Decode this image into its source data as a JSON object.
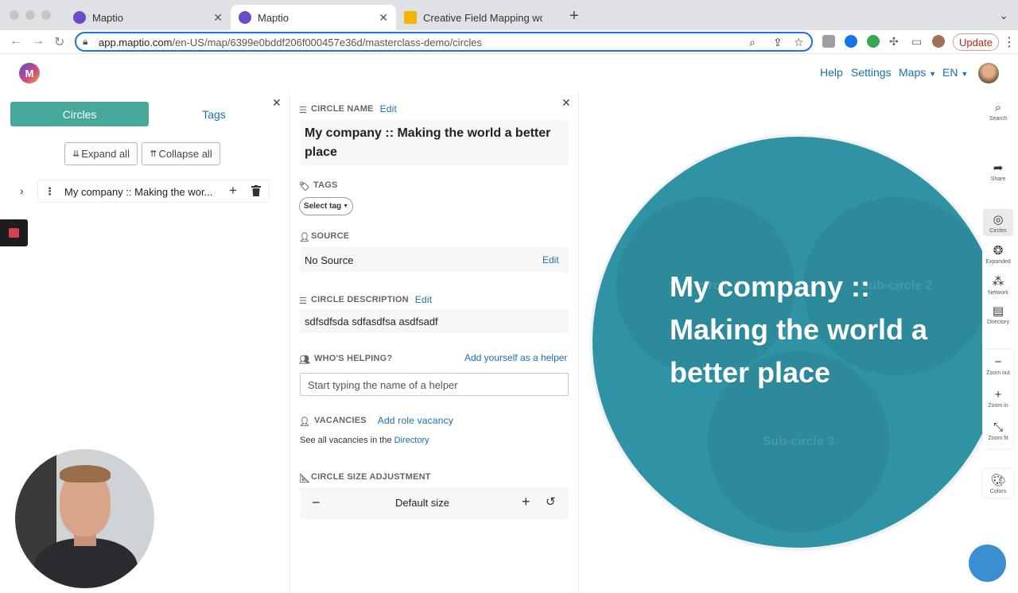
{
  "browser": {
    "tabs": [
      {
        "title": "Maptio",
        "active": false
      },
      {
        "title": "Maptio",
        "active": true
      },
      {
        "title": "Creative Field Mapping worksh",
        "active": false
      }
    ],
    "url_host": "app.maptio.com",
    "url_path": "/en-US/map/6399e0bddf206f000457e36d/masterclass-demo/circles",
    "update_label": "Update"
  },
  "header": {
    "logo_text": "M",
    "nav": {
      "help": "Help",
      "settings": "Settings",
      "maps": "Maps",
      "lang": "EN"
    }
  },
  "left_panel": {
    "tab_circles": "Circles",
    "tab_tags": "Tags",
    "expand_all": "Expand all",
    "collapse_all": "Collapse all",
    "tree_item": "My company :: Making the wor..."
  },
  "details": {
    "circle_name_label": "CIRCLE NAME",
    "edit": "Edit",
    "circle_name": "My company :: Making the world a better place",
    "tags_label": "TAGS",
    "select_tag": "Select tag",
    "source_label": "SOURCE",
    "source_value": "No Source",
    "description_label": "CIRCLE DESCRIPTION",
    "description_value": "sdfsdfsda sdfasdfsa asdfsadf",
    "helping_label": "WHO'S HELPING?",
    "add_yourself": "Add yourself as a helper",
    "helper_placeholder": "Start typing the name of a helper",
    "vacancies_label": "VACANCIES",
    "add_vacancy": "Add role vacancy",
    "vacancies_note": "See all vacancies in the",
    "directory_link": "Directory",
    "size_label": "CIRCLE SIZE ADJUSTMENT",
    "size_value": "Default size"
  },
  "map": {
    "title": "My company :: Making the world a better place",
    "sub_circles": [
      "Sub-circle 1",
      "Sub-circle 2",
      "Sub-circle 3"
    ],
    "colors": {
      "main": "#2f93a5",
      "sub": "#2c8a9a",
      "accent": "#46a898",
      "link": "#1a6fb0"
    }
  },
  "toolbar": {
    "search": "Search",
    "share": "Share",
    "circles": "Circles",
    "expanded": "Expanded",
    "network": "Network",
    "directory": "Directory",
    "zoom_out": "Zoom out",
    "zoom_in": "Zoom in",
    "zoom_fit": "Zoom fit",
    "colors": "Colors"
  }
}
